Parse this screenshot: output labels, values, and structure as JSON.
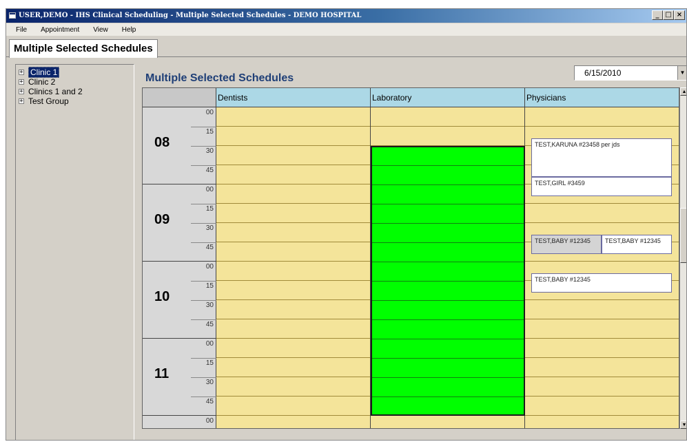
{
  "window": {
    "title": "USER,DEMO - IHS Clinical Scheduling - Multiple Selected Schedules - DEMO HOSPITAL",
    "min_glyph": "_",
    "max_glyph": "□",
    "close_glyph": "×"
  },
  "menu": [
    "File",
    "Appointment",
    "View",
    "Help"
  ],
  "tab": {
    "label": "Multiple Selected Schedules"
  },
  "tree": [
    {
      "label": "Clinic 1",
      "expander": "+",
      "selected": true
    },
    {
      "label": "Clinic 2",
      "expander": "+"
    },
    {
      "label": "Clinics 1 and 2",
      "expander": "+"
    },
    {
      "label": "Test Group",
      "expander": "+"
    }
  ],
  "main": {
    "title": "Multiple Selected Schedules",
    "date": "6/15/2010",
    "date_arrow": "▼"
  },
  "schedule": {
    "columns": [
      "Dentists",
      "Laboratory",
      "Physicians"
    ],
    "hours": [
      "08",
      "09",
      "10",
      "11"
    ],
    "minutes": [
      "00",
      "15",
      "30",
      "45"
    ],
    "trailing_minute": "00",
    "appointments": [
      {
        "text": "TEST,KARUNA #23458 per jds"
      },
      {
        "text": "TEST,GIRL #3459"
      },
      {
        "text": "TEST,BABY #12345"
      },
      {
        "text": "TEST,BABY #12345"
      },
      {
        "text": "TEST,BABY #12345"
      }
    ]
  },
  "scroll": {
    "up": "▲",
    "down": "▼"
  },
  "colors": {
    "lab_block": "#00ff00",
    "slot": "#f4e49a",
    "header": "#acd8e6",
    "title_blue": "#1f3f77"
  }
}
